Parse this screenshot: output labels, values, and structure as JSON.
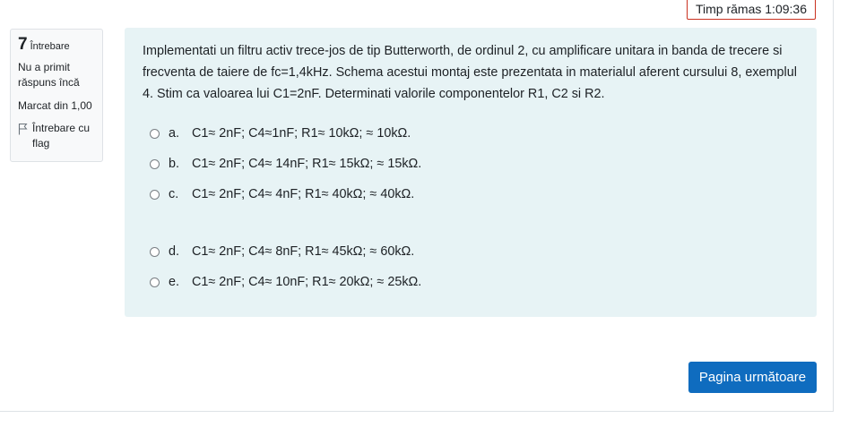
{
  "timer": {
    "label": "Timp rămas 1:09:36"
  },
  "question_info": {
    "number": "7",
    "number_label": "Întrebare",
    "state": "Nu a primit răspuns încă",
    "grade": "Marcat din 1,00",
    "flag_label": "Întrebare cu flag"
  },
  "question": {
    "text": "Implementati un filtru activ trece-jos de tip Butterworth, de ordinul 2, cu amplificare unitara in banda de trecere si frecventa de taiere de fc=1,4kHz. Schema acestui montaj este prezentata in materialul aferent cursului 8, exemplul 4. Stim ca valoarea lui C1=2nF. Determinati valorile componentelor R1, C2 si R2.",
    "answers": [
      {
        "letter": "a.",
        "text": "C1≈ 2nF; C4≈1nF; R1≈ 10kΩ; ≈ 10kΩ."
      },
      {
        "letter": "b.",
        "text": "C1≈ 2nF; C4≈ 14nF; R1≈ 15kΩ; ≈ 15kΩ."
      },
      {
        "letter": "c.",
        "text": "C1≈ 2nF; C4≈ 4nF; R1≈ 40kΩ; ≈ 40kΩ."
      },
      {
        "letter": "d.",
        "text": "C1≈ 2nF; C4≈ 8nF; R1≈ 45kΩ; ≈ 60kΩ."
      },
      {
        "letter": "e.",
        "text": "C1≈ 2nF; C4≈ 10nF; R1≈ 20kΩ; ≈ 25kΩ."
      }
    ]
  },
  "navigation": {
    "next_label": "Pagina următoare"
  },
  "colors": {
    "primary": "#0f6cbf",
    "panel_bg": "#e7f3f5",
    "timer_border": "#ca3120"
  }
}
